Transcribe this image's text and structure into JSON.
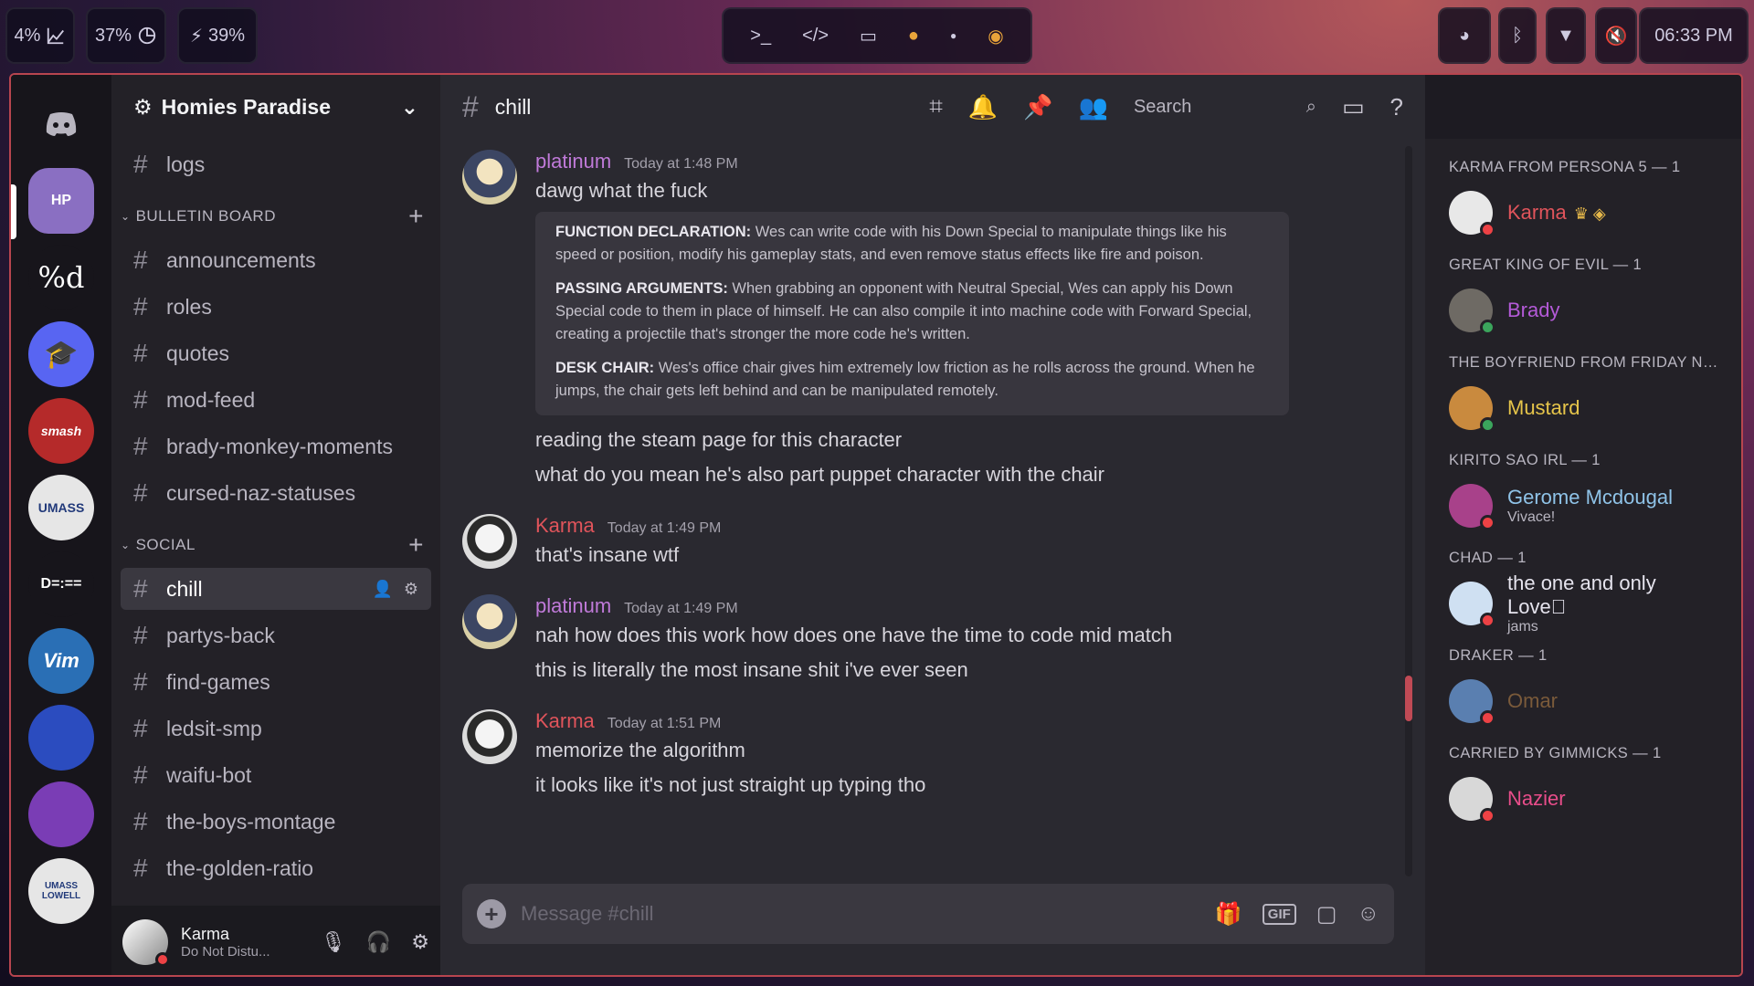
{
  "topbar": {
    "cpu": "4%",
    "mem": "37%",
    "battery": "39%",
    "clock": "06:33 PM",
    "workspace_icons": [
      "terminal-icon",
      "code-icon",
      "folder-icon",
      "firefox-icon",
      "dot-icon",
      "spotify-icon"
    ],
    "tray_icons": [
      "discord-icon",
      "bluetooth-icon",
      "wifi-icon",
      "muted-speaker-icon"
    ]
  },
  "servers": [
    {
      "label": "HP",
      "color": "#8a6fc2"
    },
    {
      "label": "%d",
      "color": "#17151b"
    },
    {
      "label": "🎓",
      "color": "#5865f2"
    },
    {
      "label": "smash",
      "color": "#b52a2a"
    },
    {
      "label": "UMASS",
      "color": "#e6e6e6"
    },
    {
      "label": "D=:==",
      "color": "#17151b"
    },
    {
      "label": "Vim",
      "color": "#2a6fb5"
    },
    {
      "label": "",
      "color": "#2b4cbf"
    },
    {
      "label": "",
      "color": "#7a3db5"
    },
    {
      "label": "UMASS LOWELL",
      "color": "#e6e6e6"
    }
  ],
  "guild": {
    "name": "Homies Paradise"
  },
  "channels_top": [
    {
      "name": "logs"
    }
  ],
  "categories": [
    {
      "name": "BULLETIN BOARD",
      "channels": [
        "announcements",
        "roles",
        "quotes",
        "mod-feed",
        "brady-monkey-moments",
        "cursed-naz-statuses"
      ]
    },
    {
      "name": "SOCIAL",
      "channels": [
        "chill",
        "partys-back",
        "find-games",
        "ledsit-smp",
        "waifu-bot",
        "the-boys-montage",
        "the-golden-ratio"
      ]
    }
  ],
  "active_channel": "chill",
  "user": {
    "name": "Karma",
    "status": "Do Not Distu..."
  },
  "chat": {
    "channel": "chill",
    "search_placeholder": "Search",
    "composer_placeholder": "Message #chill",
    "messages": [
      {
        "author": "platinum",
        "type": "plat",
        "time": "Today at 1:48 PM",
        "lines_before": [
          "dawg what the fuck"
        ],
        "embed": [
          {
            "title": "FUNCTION DECLARATION:",
            "text": " Wes can write code with his Down Special to manipulate things like his speed or position, modify his gameplay stats, and even remove status effects like fire and poison."
          },
          {
            "title": "PASSING ARGUMENTS:",
            "text": " When grabbing an opponent with Neutral Special, Wes can apply his Down Special code to them in place of himself. He can also compile it into machine code with Forward Special, creating a projectile that's stronger the more code he's written."
          },
          {
            "title": "DESK CHAIR:",
            "text": " Wes's office chair gives him extremely low friction as he rolls across the ground. When he jumps, the chair gets left behind and can be manipulated remotely."
          }
        ],
        "lines_after": [
          "reading the steam page for this character",
          "what do you mean he's also part puppet character with the chair"
        ]
      },
      {
        "author": "Karma",
        "type": "karma",
        "time": "Today at 1:49 PM",
        "lines_before": [
          "that's insane wtf"
        ]
      },
      {
        "author": "platinum",
        "type": "plat",
        "time": "Today at 1:49 PM",
        "lines_before": [
          "nah how does this work how does one have the time to code mid match",
          "this is literally the most insane shit i've ever seen"
        ]
      },
      {
        "author": "Karma",
        "type": "karma",
        "time": "Today at 1:51 PM",
        "lines_before": [
          "memorize the algorithm",
          "it looks like it's not just straight up typing tho"
        ]
      }
    ]
  },
  "members": [
    {
      "group": "KARMA FROM PERSONA 5 — 1",
      "name": "Karma",
      "color": "#e0545b",
      "status": "dnd",
      "badges": "♛ ◈",
      "av": "#e8e8e8"
    },
    {
      "group": "GREAT KING OF EVIL — 1",
      "name": "Brady",
      "color": "#b45ad8",
      "status": "online",
      "av": "#6e6a64"
    },
    {
      "group": "THE BOYFRIEND FROM FRIDAY NIG...",
      "name": "Mustard",
      "color": "#e6c54a",
      "status": "online",
      "av": "#c98a3e"
    },
    {
      "group": "KIRITO SAO IRL — 1",
      "name": "Gerome Mcdougal",
      "sub": "Vivace!",
      "color": "#8fc3e8",
      "status": "dnd",
      "av": "#a8418a"
    },
    {
      "group": "CHAD — 1",
      "name": "the one and only Love⃞",
      "sub": "jams",
      "color": "#e6e4ee",
      "status": "dnd",
      "av": "#cfe0f2"
    },
    {
      "group": "DRAKER — 1",
      "name": "Omar",
      "color": "#7a5a3a",
      "status": "dnd",
      "av": "#5a7fb0"
    },
    {
      "group": "CARRIED BY GIMMICKS — 1",
      "name": "Nazier",
      "color": "#e84d8a",
      "status": "dnd",
      "av": "#d8d8d8"
    }
  ]
}
